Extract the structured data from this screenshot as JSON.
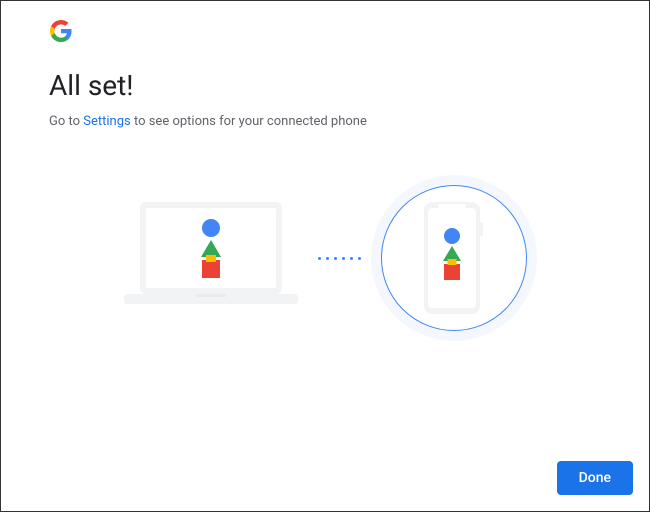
{
  "heading": "All set!",
  "subtitle": {
    "prefix": "Go to ",
    "link": "Settings",
    "suffix": " to see options for your connected phone"
  },
  "button": {
    "done": "Done"
  },
  "colors": {
    "blue": "#4285f4",
    "red": "#ea4335",
    "yellow": "#fbbc04",
    "green": "#34a853"
  }
}
